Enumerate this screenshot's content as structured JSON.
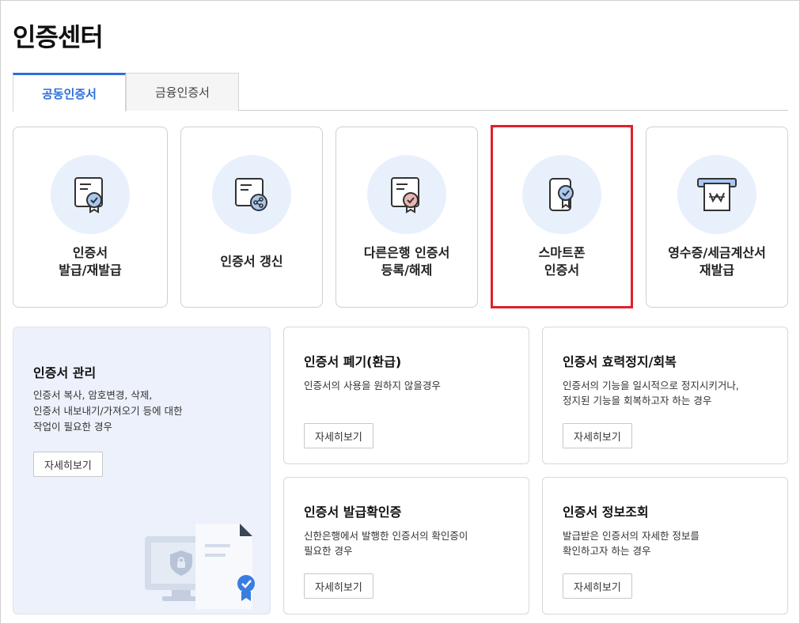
{
  "page_title": "인증센터",
  "tabs": [
    {
      "label": "공동인증서",
      "active": true
    },
    {
      "label": "금융인증서",
      "active": false
    }
  ],
  "cards": [
    {
      "icon": "certificate-check-icon",
      "lines": [
        "인증서",
        "발급/재발급"
      ]
    },
    {
      "icon": "certificate-renew-icon",
      "lines": [
        "인증서 갱신"
      ]
    },
    {
      "icon": "certificate-register-icon",
      "lines": [
        "다른은행 인증서",
        "등록/해제"
      ]
    },
    {
      "icon": "smartphone-certificate-icon",
      "lines": [
        "스마트폰",
        "인증서"
      ]
    },
    {
      "icon": "receipt-won-icon",
      "lines": [
        "영수증/세금계산서",
        "재발급"
      ]
    }
  ],
  "manage": {
    "title": "인증서 관리",
    "desc": [
      "인증서 복사, 암호변경, 삭제,",
      "인증서 내보내기/가져오기 등에 대한",
      "작업이 필요한 경우"
    ],
    "button": "자세히보기"
  },
  "info_cards": [
    {
      "title": "인증서 폐기(환급)",
      "desc": [
        "인증서의 사용을 원하지 않을경우"
      ],
      "button": "자세히보기"
    },
    {
      "title": "인증서 효력정지/회복",
      "desc": [
        "인증서의 기능을 일시적으로 정지시키거나,",
        "정지된 기능을 회복하고자 하는 경우"
      ],
      "button": "자세히보기"
    },
    {
      "title": "인증서 발급확인증",
      "desc": [
        "신한은행에서 발행한 인증서의 확인증이",
        "필요한 경우"
      ],
      "button": "자세히보기"
    },
    {
      "title": "인증서 정보조회",
      "desc": [
        "발급받은 인증서의 자세한 정보를",
        "확인하고자 하는 경우"
      ],
      "button": "자세히보기"
    }
  ],
  "colors": {
    "accent": "#2d6ed8",
    "highlight": "#e0202a",
    "icon_bg": "#e8f0fc"
  }
}
